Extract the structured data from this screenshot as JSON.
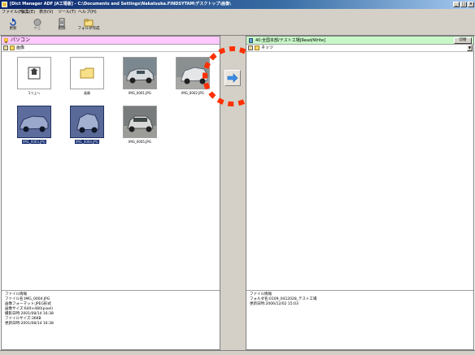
{
  "window": {
    "title": "[Dict Manager ADF JA工場版] - C:\\Documents and Settings\\Nakatsuka.FINDSYTAM\\デスクトップ\\画像\\",
    "minimize": "_",
    "maximize": "□",
    "close": "×"
  },
  "menu": [
    "ファイル(F)",
    "編集(E)",
    "表示(V)",
    "ツール(T)",
    "ヘルプ(H)"
  ],
  "toolbar": [
    {
      "label": "更新",
      "icon": "refresh-icon"
    },
    {
      "label": "中止",
      "icon": "stop-icon"
    },
    {
      "label": "削除",
      "icon": "delete-icon"
    },
    {
      "label": "フォルダ作成",
      "icon": "new-folder-icon"
    }
  ],
  "left": {
    "header": "パソコン",
    "path": "画像",
    "items": [
      {
        "name": "1つ上へ",
        "kind": "up"
      },
      {
        "name": "画像",
        "kind": "folder"
      },
      {
        "name": "IMG_0001.JPG",
        "kind": "photo"
      },
      {
        "name": "IMG_0002.JPG",
        "kind": "photo"
      },
      {
        "name": "IMG_0003.JPG",
        "kind": "photo",
        "selected": true
      },
      {
        "name": "IMG_0004.JPG",
        "kind": "photo",
        "selected": true
      },
      {
        "name": "IMG_0005.JPG",
        "kind": "photo"
      }
    ],
    "info": [
      "ファイル情報",
      "ファイル名:IMG_0004.JPG",
      "画像フォーマット:JPEG形式",
      "画像サイズ:640×480(pixel)",
      "撮影日時:2001/08/14 16:38",
      "ファイルサイズ:36KB",
      "更新日時:2001/08/14 16:38"
    ]
  },
  "right": {
    "header": "40:全国本部/テスト工場[Read/Write]",
    "switch_button": "切替",
    "path": "ネッツ",
    "info": [
      "ファイル情報",
      "フォルダ名:0109_0412028_テスト工場",
      "更新日時:2006/12/02 15:03"
    ]
  },
  "colors": {
    "title_bar": "#0a246a",
    "left_header": "#ffc8ff",
    "right_header": "#c8f8c8",
    "highlight_circle": "#ff3000",
    "transfer_arrow": "#3a8ee8"
  }
}
